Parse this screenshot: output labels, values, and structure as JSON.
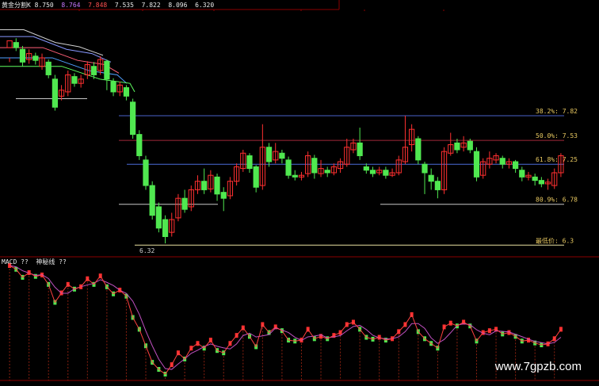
{
  "header": {
    "title": "黄金分割K",
    "values": [
      "8.750",
      "8.764",
      "7.848",
      "7.535",
      "7.822",
      "8.096",
      "6.320"
    ]
  },
  "indicator": {
    "title": "MACD",
    "v1": "??",
    "v2": "??",
    "label": "神秘线"
  },
  "watermark": "www.7gpzb.com",
  "colors": {
    "up": "#ff3030",
    "down": "#50e850",
    "grid": "#8b0000",
    "l382": "#4a62c9",
    "l500": "#a02838",
    "l618": "#4a6ad8",
    "l809": "#c8c8c8",
    "low": "#e8e0a0"
  },
  "chart_data": {
    "type": "candlestick",
    "levels": [
      {
        "label": "38.2%: 7.82",
        "value": 7.82
      },
      {
        "label": "50.0%: 7.53",
        "value": 7.53
      },
      {
        "label": "61.8%: 7.25",
        "value": 7.25
      },
      {
        "label": "80.9%: 6.78",
        "value": 6.78
      },
      {
        "label": "最低价: 6.3",
        "value": 6.3
      }
    ],
    "low_marker": "6.32",
    "ylim": [
      6.2,
      8.9
    ],
    "candles": [
      [
        8.62,
        8.7,
        8.5,
        8.45
      ],
      [
        8.68,
        8.62,
        8.73,
        8.58
      ],
      [
        8.6,
        8.45,
        8.64,
        8.4
      ],
      [
        8.48,
        8.55,
        8.6,
        8.43
      ],
      [
        8.52,
        8.47,
        8.56,
        8.42
      ],
      [
        8.4,
        8.5,
        8.55,
        8.36
      ],
      [
        8.45,
        8.3,
        8.48,
        8.26
      ],
      [
        8.25,
        7.92,
        8.3,
        7.88
      ],
      [
        8.05,
        8.12,
        8.18,
        8.0
      ],
      [
        8.1,
        8.3,
        8.35,
        8.05
      ],
      [
        8.28,
        8.2,
        8.32,
        8.16
      ],
      [
        8.2,
        8.25,
        8.3,
        8.15
      ],
      [
        8.3,
        8.42,
        8.46,
        8.25
      ],
      [
        8.4,
        8.3,
        8.45,
        8.25
      ],
      [
        8.35,
        8.48,
        8.52,
        8.3
      ],
      [
        8.46,
        8.25,
        8.48,
        8.12
      ],
      [
        8.22,
        8.1,
        8.26,
        8.05
      ],
      [
        8.1,
        8.18,
        8.22,
        8.05
      ],
      [
        8.15,
        8.05,
        8.18,
        8.0
      ],
      [
        7.98,
        7.6,
        8.02,
        7.55
      ],
      [
        7.6,
        7.35,
        7.65,
        7.3
      ],
      [
        7.3,
        7.0,
        7.35,
        6.95
      ],
      [
        7.0,
        6.65,
        7.05,
        6.6
      ],
      [
        6.75,
        6.5,
        6.8,
        6.45
      ],
      [
        6.6,
        6.4,
        6.65,
        6.32
      ],
      [
        6.45,
        6.6,
        6.68,
        6.4
      ],
      [
        6.62,
        6.85,
        6.9,
        6.58
      ],
      [
        6.85,
        6.72,
        6.95,
        6.68
      ],
      [
        6.75,
        6.95,
        7.0,
        6.7
      ],
      [
        6.95,
        7.05,
        7.12,
        6.9
      ],
      [
        7.05,
        6.95,
        7.2,
        6.9
      ],
      [
        6.96,
        7.12,
        7.18,
        6.92
      ],
      [
        7.1,
        6.9,
        7.14,
        6.82
      ],
      [
        6.92,
        6.85,
        6.98,
        6.7
      ],
      [
        6.88,
        7.05,
        7.1,
        6.84
      ],
      [
        7.05,
        7.22,
        7.26,
        7.0
      ],
      [
        7.2,
        7.38,
        7.42,
        7.16
      ],
      [
        7.35,
        7.2,
        7.38,
        7.15
      ],
      [
        7.22,
        6.98,
        7.24,
        6.92
      ],
      [
        7.0,
        7.45,
        7.72,
        6.95
      ],
      [
        7.45,
        7.28,
        7.5,
        7.22
      ],
      [
        7.3,
        7.4,
        7.5,
        7.26
      ],
      [
        7.38,
        7.32,
        7.42,
        7.26
      ],
      [
        7.3,
        7.12,
        7.34,
        7.08
      ],
      [
        7.12,
        7.1,
        7.18,
        7.06
      ],
      [
        7.1,
        7.12,
        7.16,
        7.06
      ],
      [
        7.14,
        7.35,
        7.4,
        7.1
      ],
      [
        7.32,
        7.15,
        7.36,
        7.08
      ],
      [
        7.14,
        7.2,
        7.3,
        7.1
      ],
      [
        7.18,
        7.15,
        7.22,
        7.1
      ],
      [
        7.15,
        7.22,
        7.26,
        7.12
      ],
      [
        7.2,
        7.28,
        7.32,
        7.15
      ],
      [
        7.25,
        7.45,
        7.55,
        7.22
      ],
      [
        7.42,
        7.5,
        7.55,
        7.38
      ],
      [
        7.5,
        7.35,
        7.68,
        7.3
      ],
      [
        7.22,
        7.18,
        7.26,
        7.14
      ],
      [
        7.18,
        7.14,
        7.22,
        7.1
      ],
      [
        7.15,
        7.18,
        7.22,
        7.12
      ],
      [
        7.18,
        7.12,
        7.22,
        7.08
      ],
      [
        7.12,
        7.15,
        7.2,
        7.1
      ],
      [
        7.15,
        7.3,
        7.35,
        7.12
      ],
      [
        7.28,
        7.45,
        7.82,
        7.25
      ],
      [
        7.48,
        7.66,
        7.72,
        7.4
      ],
      [
        7.55,
        7.3,
        7.58,
        7.25
      ],
      [
        7.25,
        7.15,
        7.28,
        6.9
      ],
      [
        7.12,
        7.05,
        7.2,
        6.95
      ],
      [
        7.05,
        6.95,
        7.1,
        6.85
      ],
      [
        6.95,
        7.4,
        7.45,
        6.9
      ],
      [
        7.38,
        7.48,
        7.62,
        7.35
      ],
      [
        7.5,
        7.42,
        7.55,
        7.38
      ],
      [
        7.45,
        7.5,
        7.58,
        7.4
      ],
      [
        7.52,
        7.42,
        7.55,
        7.38
      ],
      [
        7.4,
        7.1,
        7.45,
        7.05
      ],
      [
        7.12,
        7.28,
        7.32,
        7.08
      ],
      [
        7.25,
        7.32,
        7.4,
        7.2
      ],
      [
        7.3,
        7.35,
        7.38,
        7.26
      ],
      [
        7.32,
        7.25,
        7.35,
        7.2
      ],
      [
        7.25,
        7.28,
        7.32,
        7.2
      ],
      [
        7.28,
        7.2,
        7.3,
        7.15
      ],
      [
        7.18,
        7.1,
        7.22,
        7.05
      ],
      [
        7.1,
        7.12,
        7.16,
        7.06
      ],
      [
        7.1,
        7.06,
        7.14,
        7.0
      ],
      [
        7.06,
        7.02,
        7.1,
        6.98
      ],
      [
        7.02,
        7.04,
        7.08,
        6.95
      ],
      [
        7.0,
        7.15,
        7.2,
        6.96
      ],
      [
        7.15,
        7.35,
        7.38,
        7.1
      ]
    ]
  }
}
